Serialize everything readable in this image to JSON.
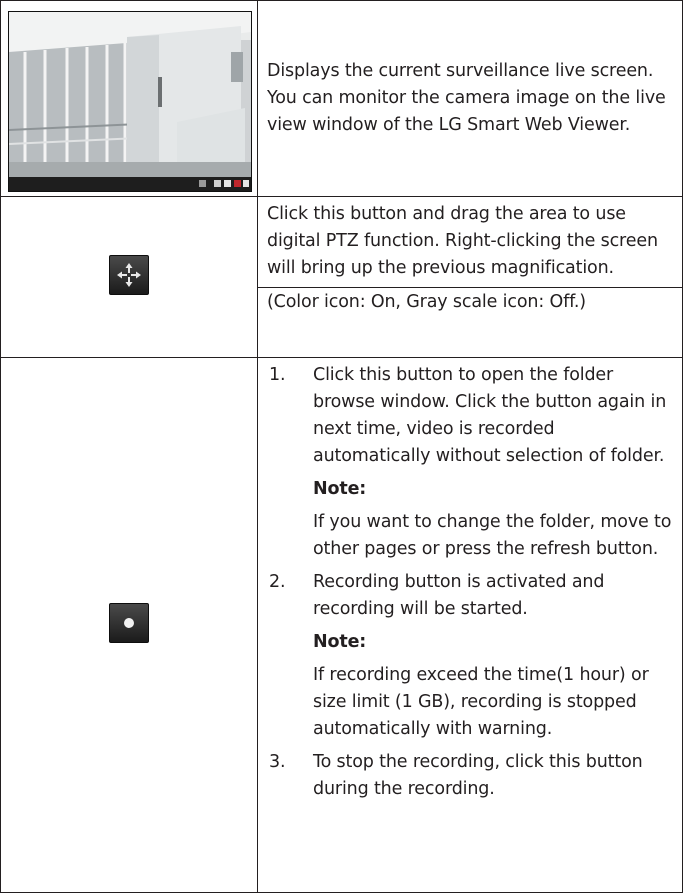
{
  "rows": [
    {
      "text": "Displays the current surveillance live screen. You can monitor the camera image on the live view window of the LG Smart Web Viewer."
    },
    {
      "text": "Click this button and drag the area to use digital PTZ function. Right-clicking the screen will bring up the previous magnification.",
      "subtext": "(Color icon: On, Gray scale icon: Off.)"
    },
    {
      "steps": [
        {
          "num": "1.",
          "text": "Click this button to open the folder browse window. Click the button again in next time, video is recorded automatically without selection of folder.",
          "note_label": "Note:",
          "note_text": "If you want to change the folder, move to other pages or press the refresh button."
        },
        {
          "num": "2.",
          "text": "Recording button is activated and recording will be started.",
          "note_label": "Note:",
          "note_text": "If recording exceed the time(1 hour) or size limit (1 GB), recording is stopped automatically with warning."
        },
        {
          "num": "3.",
          "text": "To stop the recording, click this button during the recording."
        }
      ]
    }
  ],
  "icons": {
    "live_view": "live-view-thumbnail",
    "ptz": "digital-ptz-icon",
    "record": "record-icon"
  }
}
